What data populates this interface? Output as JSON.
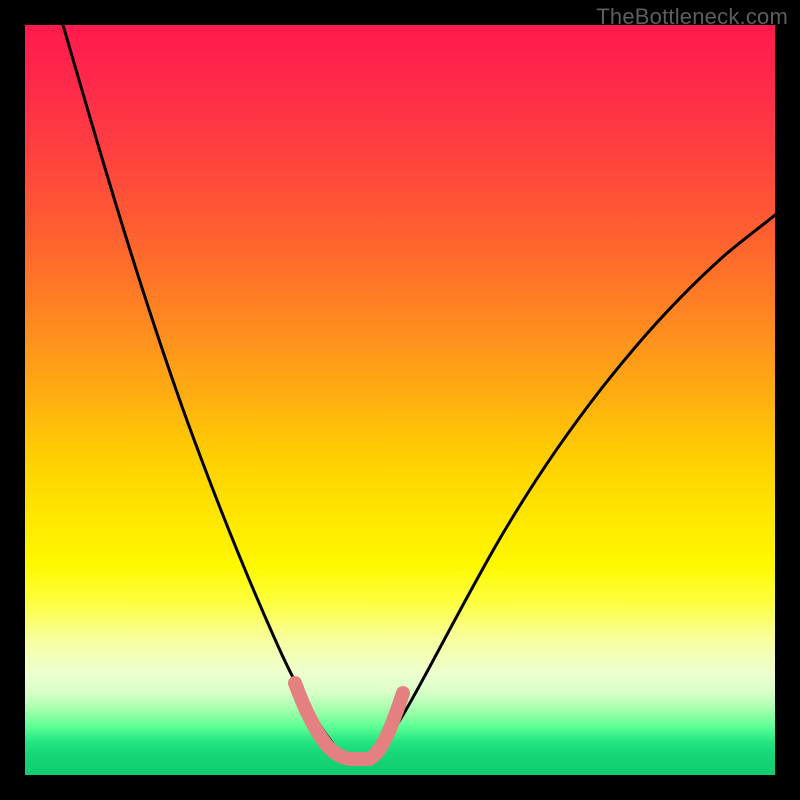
{
  "watermark": "TheBottleneck.com",
  "colors": {
    "frame": "#000000",
    "curve": "#000000",
    "highlight": "#e58080",
    "gradient_top": "#ff1a4d",
    "gradient_bottom": "#10cc70"
  },
  "chart_data": {
    "type": "line",
    "title": "",
    "xlabel": "",
    "ylabel": "",
    "xlim": [
      0,
      100
    ],
    "ylim": [
      0,
      100
    ],
    "legend": false,
    "grid": false,
    "notes": "V-shaped bottleneck curve on rainbow gradient. Red=high bottleneck, green=optimal. Optimal zone highlighted in salmon near x≈36–47.",
    "series": [
      {
        "name": "left-branch",
        "x": [
          5,
          10,
          15,
          20,
          25,
          28,
          30,
          32,
          34,
          36,
          38,
          40,
          42
        ],
        "y": [
          100,
          80,
          61,
          44,
          29,
          21,
          16,
          12,
          8,
          5,
          3,
          2,
          1.5
        ]
      },
      {
        "name": "right-branch",
        "x": [
          42,
          45,
          48,
          52,
          58,
          65,
          72,
          80,
          88,
          96,
          100
        ],
        "y": [
          1.5,
          2,
          4,
          8,
          16,
          26,
          36,
          47,
          58,
          68,
          73
        ]
      },
      {
        "name": "optimal-highlight",
        "x": [
          36,
          38,
          40,
          42,
          44,
          46,
          47
        ],
        "y": [
          5,
          3,
          2,
          1.5,
          1.5,
          2.5,
          5
        ]
      }
    ]
  }
}
